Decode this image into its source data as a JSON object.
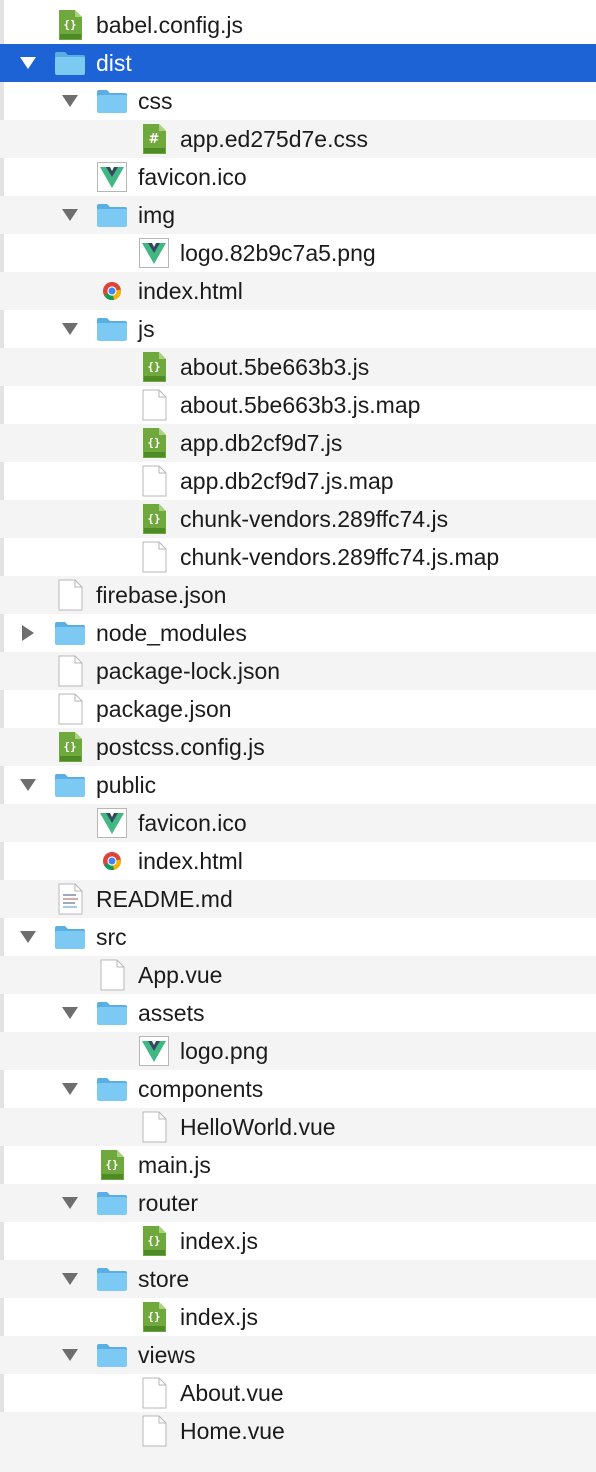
{
  "colors": {
    "selection": "#1e63d6",
    "folder": "#7ccaf4",
    "folder_tab": "#5aaee4",
    "js_green": "#6fa83d",
    "vue_green": "#41b883",
    "vue_navy": "#35495e",
    "row_alt": "#f4f4f4"
  },
  "tree": [
    {
      "label": "babel.config.js",
      "icon": "js-file-icon",
      "depth": 0,
      "kind": "file"
    },
    {
      "label": "dist",
      "icon": "folder-icon",
      "depth": 0,
      "kind": "folder",
      "expanded": true,
      "selected": true
    },
    {
      "label": "css",
      "icon": "folder-icon",
      "depth": 1,
      "kind": "folder",
      "expanded": true
    },
    {
      "label": "app.ed275d7e.css",
      "icon": "css-file-icon",
      "depth": 2,
      "kind": "file"
    },
    {
      "label": "favicon.ico",
      "icon": "vue-file-icon",
      "depth": 1,
      "kind": "file"
    },
    {
      "label": "img",
      "icon": "folder-icon",
      "depth": 1,
      "kind": "folder",
      "expanded": true
    },
    {
      "label": "logo.82b9c7a5.png",
      "icon": "vue-file-icon",
      "depth": 2,
      "kind": "file"
    },
    {
      "label": "index.html",
      "icon": "chrome-file-icon",
      "depth": 1,
      "kind": "file"
    },
    {
      "label": "js",
      "icon": "folder-icon",
      "depth": 1,
      "kind": "folder",
      "expanded": true
    },
    {
      "label": "about.5be663b3.js",
      "icon": "js-file-icon",
      "depth": 2,
      "kind": "file"
    },
    {
      "label": "about.5be663b3.js.map",
      "icon": "blank-file-icon",
      "depth": 2,
      "kind": "file"
    },
    {
      "label": "app.db2cf9d7.js",
      "icon": "js-file-icon",
      "depth": 2,
      "kind": "file"
    },
    {
      "label": "app.db2cf9d7.js.map",
      "icon": "blank-file-icon",
      "depth": 2,
      "kind": "file"
    },
    {
      "label": "chunk-vendors.289ffc74.js",
      "icon": "js-file-icon",
      "depth": 2,
      "kind": "file"
    },
    {
      "label": "chunk-vendors.289ffc74.js.map",
      "icon": "blank-file-icon",
      "depth": 2,
      "kind": "file"
    },
    {
      "label": "firebase.json",
      "icon": "blank-file-icon",
      "depth": 0,
      "kind": "file"
    },
    {
      "label": "node_modules",
      "icon": "folder-icon",
      "depth": 0,
      "kind": "folder",
      "expanded": false
    },
    {
      "label": "package-lock.json",
      "icon": "blank-file-icon",
      "depth": 0,
      "kind": "file"
    },
    {
      "label": "package.json",
      "icon": "blank-file-icon",
      "depth": 0,
      "kind": "file"
    },
    {
      "label": "postcss.config.js",
      "icon": "js-file-icon",
      "depth": 0,
      "kind": "file"
    },
    {
      "label": "public",
      "icon": "folder-icon",
      "depth": 0,
      "kind": "folder",
      "expanded": true
    },
    {
      "label": "favicon.ico",
      "icon": "vue-file-icon",
      "depth": 1,
      "kind": "file"
    },
    {
      "label": "index.html",
      "icon": "chrome-file-icon",
      "depth": 1,
      "kind": "file"
    },
    {
      "label": "README.md",
      "icon": "text-file-icon",
      "depth": 0,
      "kind": "file"
    },
    {
      "label": "src",
      "icon": "folder-icon",
      "depth": 0,
      "kind": "folder",
      "expanded": true
    },
    {
      "label": "App.vue",
      "icon": "blank-file-icon",
      "depth": 1,
      "kind": "file"
    },
    {
      "label": "assets",
      "icon": "folder-icon",
      "depth": 1,
      "kind": "folder",
      "expanded": true
    },
    {
      "label": "logo.png",
      "icon": "vue-file-icon",
      "depth": 2,
      "kind": "file"
    },
    {
      "label": "components",
      "icon": "folder-icon",
      "depth": 1,
      "kind": "folder",
      "expanded": true
    },
    {
      "label": "HelloWorld.vue",
      "icon": "blank-file-icon",
      "depth": 2,
      "kind": "file"
    },
    {
      "label": "main.js",
      "icon": "js-file-icon",
      "depth": 1,
      "kind": "file"
    },
    {
      "label": "router",
      "icon": "folder-icon",
      "depth": 1,
      "kind": "folder",
      "expanded": true
    },
    {
      "label": "index.js",
      "icon": "js-file-icon",
      "depth": 2,
      "kind": "file"
    },
    {
      "label": "store",
      "icon": "folder-icon",
      "depth": 1,
      "kind": "folder",
      "expanded": true
    },
    {
      "label": "index.js",
      "icon": "js-file-icon",
      "depth": 2,
      "kind": "file"
    },
    {
      "label": "views",
      "icon": "folder-icon",
      "depth": 1,
      "kind": "folder",
      "expanded": true
    },
    {
      "label": "About.vue",
      "icon": "blank-file-icon",
      "depth": 2,
      "kind": "file"
    },
    {
      "label": "Home.vue",
      "icon": "blank-file-icon",
      "depth": 2,
      "kind": "file"
    }
  ]
}
